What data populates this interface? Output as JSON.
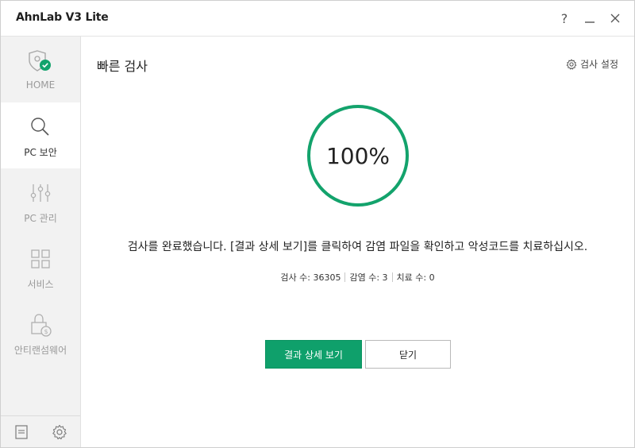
{
  "window": {
    "title": "AhnLab V3 Lite",
    "help_label": "?",
    "minimize_label": "—",
    "close_label": "✕"
  },
  "sidebar": {
    "items": [
      {
        "label": "HOME",
        "icon": "shield-check-icon",
        "active": false
      },
      {
        "label": "PC 보안",
        "icon": "search-icon",
        "active": true
      },
      {
        "label": "PC 관리",
        "icon": "sliders-icon",
        "active": false
      },
      {
        "label": "서비스",
        "icon": "grid-icon",
        "active": false
      },
      {
        "label": "안티랜섬웨어",
        "icon": "lock-icon",
        "active": false
      }
    ],
    "bottom": [
      {
        "icon": "report-icon"
      },
      {
        "icon": "gear-icon"
      }
    ]
  },
  "main": {
    "title": "빠른 검사",
    "settings_label": "검사 설정",
    "progress": {
      "value": 100,
      "text": "100%"
    },
    "message": "검사를 완료했습니다. [결과 상세 보기]를 클릭하여 감염 파일을 확인하고 악성코드를 치료하십시오.",
    "stats": [
      {
        "text": "검사 수: 36305"
      },
      {
        "text": "감염 수: 3"
      },
      {
        "text": "치료 수: 0"
      }
    ],
    "primary_button": "결과 상세 보기",
    "secondary_button": "닫기"
  },
  "colors": {
    "accent": "#0fa06b",
    "sidebar_bg": "#f2f2f2",
    "ring": "#13a36c"
  }
}
